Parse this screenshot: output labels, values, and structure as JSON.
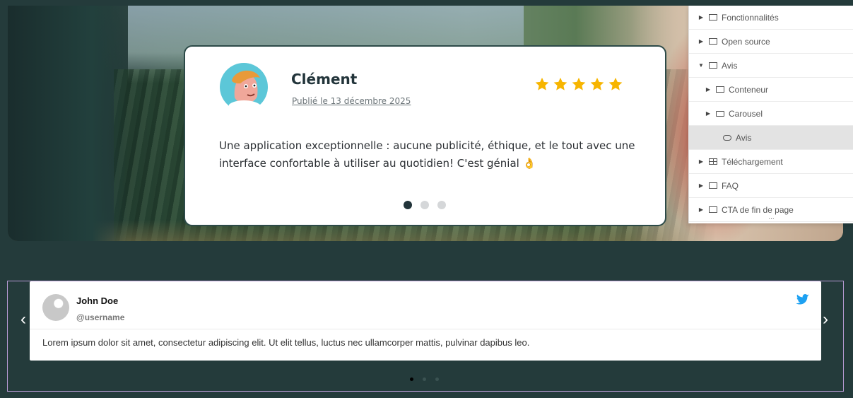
{
  "review": {
    "name": "Clément",
    "date": "Publié le 13 décembre 2025",
    "rating": 5,
    "text": "Une application exceptionnelle : aucune publicité, éthique, et le tout avec une interface confortable à utiliser au quotidien! C'est génial 👌",
    "slides": 3,
    "active_slide": 1
  },
  "navigator": {
    "items": [
      {
        "label": "Fonctionnalités",
        "caret": "▶",
        "icon": "container-icon"
      },
      {
        "label": "Open source",
        "caret": "▶",
        "icon": "container-icon"
      },
      {
        "label": "Avis",
        "caret": "▼",
        "icon": "container-icon"
      },
      {
        "label": "Conteneur",
        "caret": "▶",
        "icon": "container-icon"
      },
      {
        "label": "Carousel",
        "caret": "▶",
        "icon": "carousel-icon"
      },
      {
        "label": "Avis",
        "caret": "",
        "icon": "widget-icon"
      },
      {
        "label": "Téléchargement",
        "caret": "▶",
        "icon": "grid-icon"
      },
      {
        "label": "FAQ",
        "caret": "▶",
        "icon": "container-icon"
      },
      {
        "label": "CTA de fin de page",
        "caret": "▶",
        "icon": "container-icon"
      }
    ],
    "more": "..."
  },
  "twitter": {
    "name": "John Doe",
    "handle": "@username",
    "text": "Lorem ipsum dolor sit amet, consectetur adipiscing elit. Ut elit tellus, luctus nec ullamcorper mattis, pulvinar dapibus leo.",
    "prev": "‹",
    "next": "›",
    "slides": 3,
    "active_slide": 1
  },
  "colors": {
    "star": "#f7b500",
    "twitter_blue": "#1da1f2",
    "dark_bg": "#243b3b"
  }
}
